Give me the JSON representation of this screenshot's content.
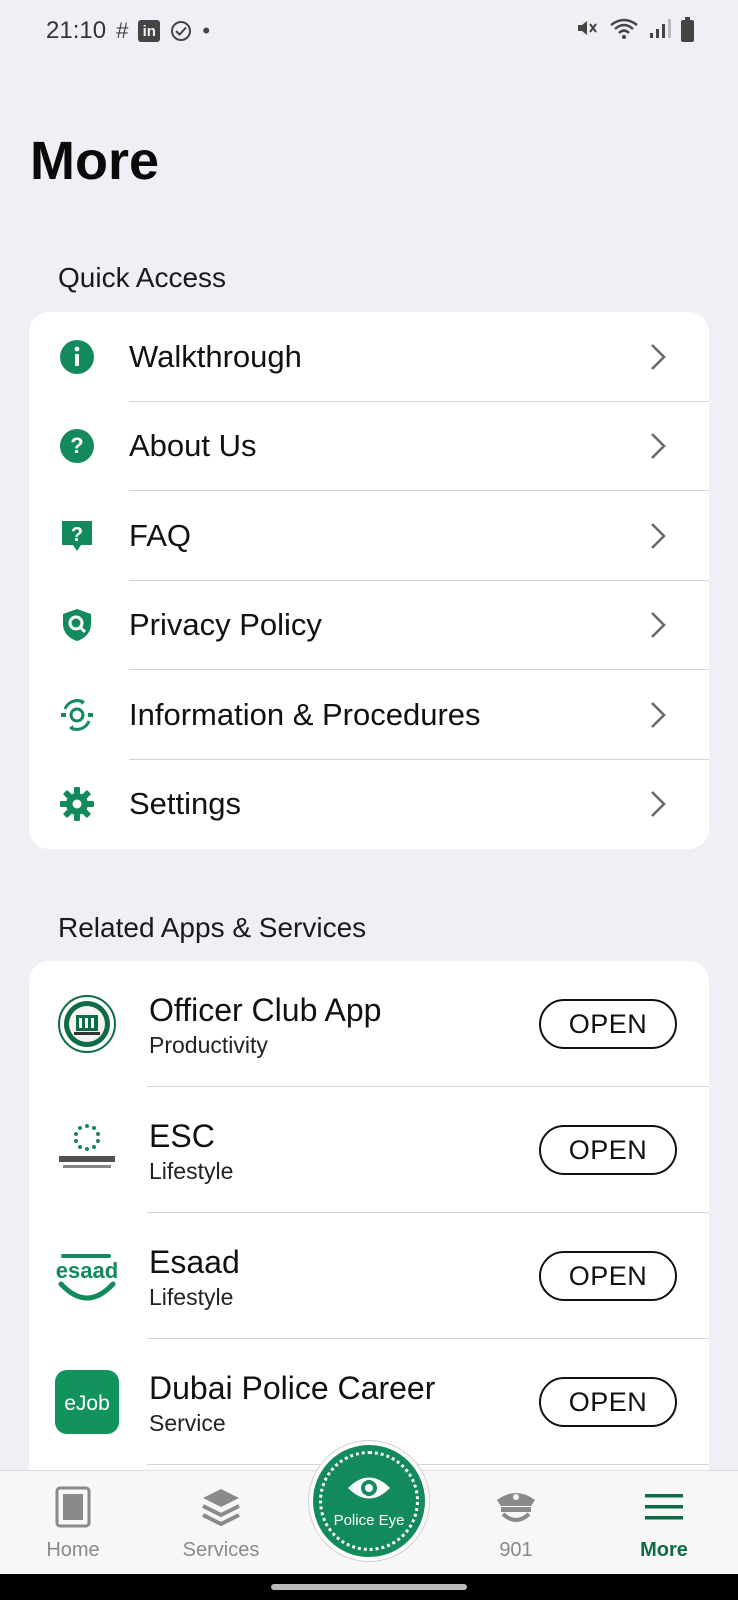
{
  "status_bar": {
    "time": "21:10",
    "left_icons": [
      "hash-icon",
      "linkedin-icon",
      "check-circle-icon",
      "dot-icon"
    ],
    "right_icons": [
      "mute-icon",
      "wifi-icon",
      "signal-icon",
      "battery-icon"
    ]
  },
  "page": {
    "title": "More"
  },
  "quick_access": {
    "label": "Quick Access",
    "items": [
      {
        "label": "Walkthrough",
        "icon": "info-icon"
      },
      {
        "label": "About Us",
        "icon": "question-circle-icon"
      },
      {
        "label": "FAQ",
        "icon": "faq-icon"
      },
      {
        "label": "Privacy Policy",
        "icon": "shield-search-icon"
      },
      {
        "label": "Information & Procedures",
        "icon": "procedures-icon"
      },
      {
        "label": "Settings",
        "icon": "gear-icon"
      }
    ]
  },
  "related_apps": {
    "label": "Related Apps & Services",
    "open_label": "OPEN",
    "items": [
      {
        "name": "Officer Club App",
        "category": "Productivity",
        "logo": "officer-club-logo"
      },
      {
        "name": "ESC",
        "category": "Lifestyle",
        "logo": "esc-logo"
      },
      {
        "name": "Esaad",
        "category": "Lifestyle",
        "logo": "esaad-logo",
        "logo_text": "esaad"
      },
      {
        "name": "Dubai Police Career",
        "category": "Service",
        "logo": "ejob-logo",
        "logo_text": "eJob"
      }
    ]
  },
  "bottom_nav": {
    "items": [
      {
        "label": "Home",
        "icon": "home-icon"
      },
      {
        "label": "Services",
        "icon": "layers-icon"
      },
      {
        "label": "901",
        "icon": "officer-hat-icon"
      },
      {
        "label": "More",
        "icon": "menu-icon",
        "active": true
      }
    ],
    "fab_label": "Police Eye"
  },
  "colors": {
    "accent": "#138a5b",
    "accent_dark": "#0d6b45",
    "background": "#eff0f5",
    "card": "#ffffff"
  }
}
